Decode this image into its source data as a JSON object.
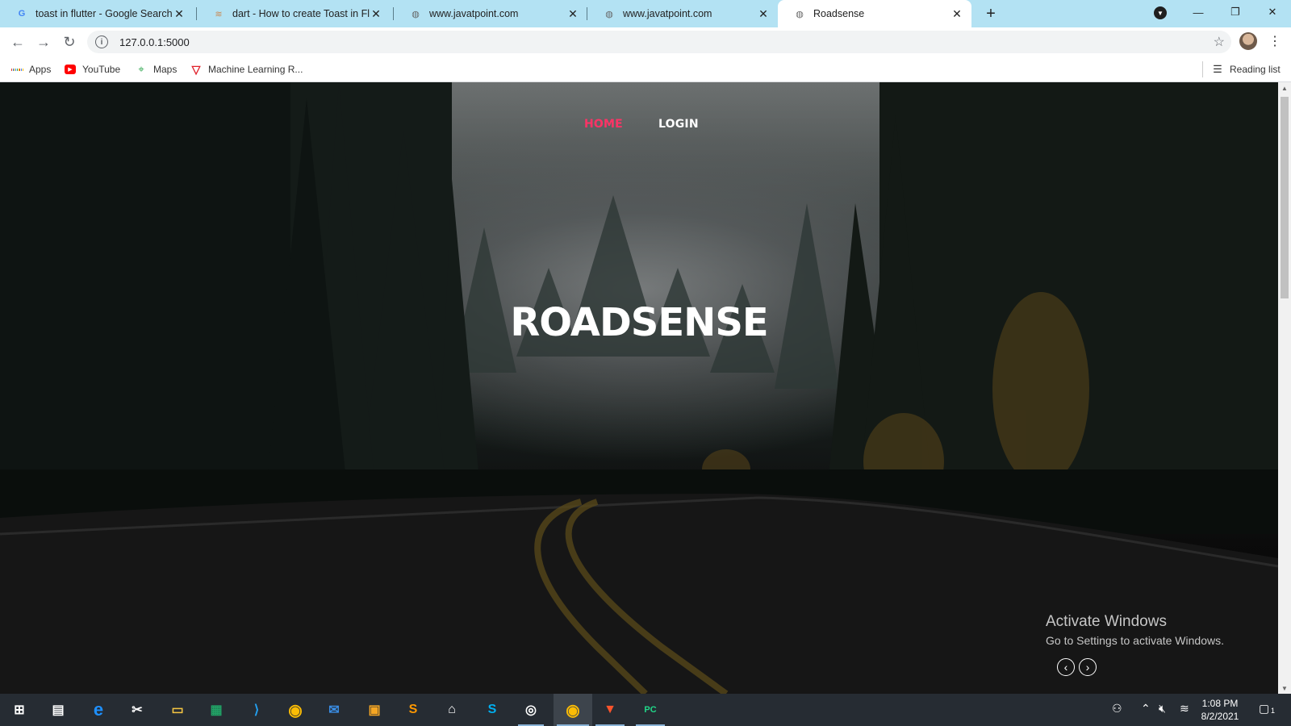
{
  "browser": {
    "tabs": [
      {
        "title": "toast in flutter - Google Search",
        "icon": "google-icon",
        "active": false
      },
      {
        "title": "dart - How to create Toast in Flut",
        "icon": "stackoverflow-icon",
        "active": false
      },
      {
        "title": "www.javatpoint.com",
        "icon": "globe-icon",
        "active": false
      },
      {
        "title": "www.javatpoint.com",
        "icon": "globe-icon",
        "active": false
      },
      {
        "title": "Roadsense",
        "icon": "globe-icon",
        "active": true
      }
    ],
    "url": "127.0.0.1:5000",
    "bookmarks": [
      {
        "label": "Apps",
        "icon": "apps-grid-icon"
      },
      {
        "label": "YouTube",
        "icon": "youtube-icon"
      },
      {
        "label": "Maps",
        "icon": "maps-icon"
      },
      {
        "label": "Machine Learning R...",
        "icon": "ml-site-icon"
      }
    ],
    "reading_list": "Reading list"
  },
  "page": {
    "nav": {
      "home": "HOME",
      "login": "LOGIN"
    },
    "hero_title": "ROADSENSE",
    "colors": {
      "nav_active": "#ff3366",
      "nav_default": "#ffffff"
    }
  },
  "watermark": {
    "title": "Activate Windows",
    "subtitle": "Go to Settings to activate Windows."
  },
  "carousel": {
    "prev": "‹",
    "next": "›"
  },
  "taskbar": {
    "time": "1:08 PM",
    "date": "8/2/2021",
    "notification_count": "1",
    "apps": [
      "start-icon",
      "task-view-icon",
      "edge-icon",
      "snipping-tool-icon",
      "file-explorer-icon",
      "excel-icon",
      "vscode-icon",
      "chrome-icon",
      "mail-icon",
      "calendar-icon",
      "sublime-icon",
      "store-icon",
      "skype-icon",
      "app-icon",
      "chrome-running-icon",
      "brave-icon",
      "pycharm-icon"
    ]
  }
}
